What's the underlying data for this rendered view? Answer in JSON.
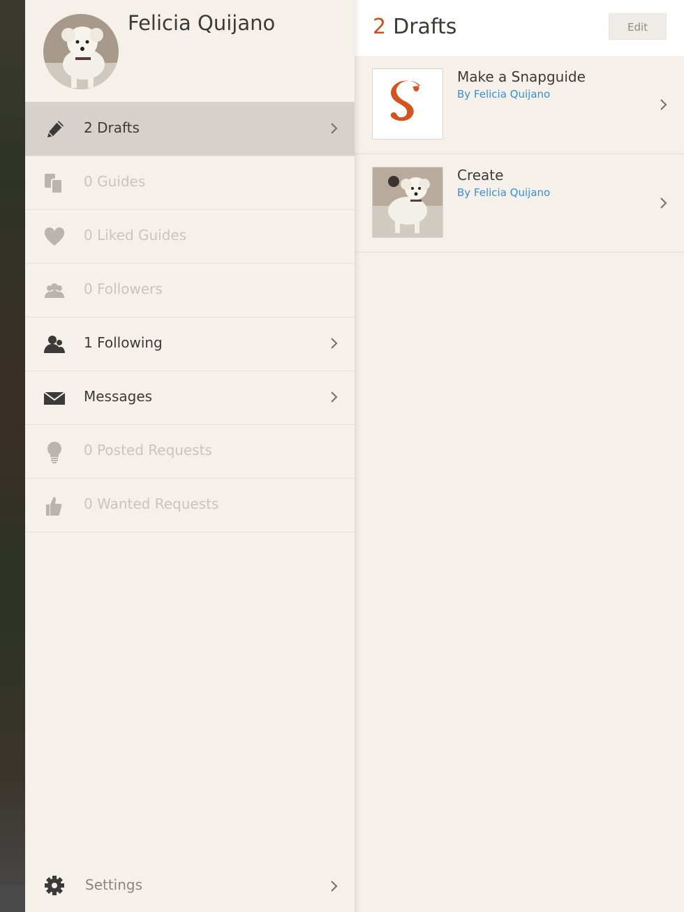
{
  "profile": {
    "name": "Felicia Quijano"
  },
  "sidebar": {
    "items": [
      {
        "label": "2 Drafts",
        "icon": "pencil-icon",
        "active": true,
        "enabled": true
      },
      {
        "label": "0 Guides",
        "icon": "guides-icon",
        "active": false,
        "enabled": false
      },
      {
        "label": "0 Liked Guides",
        "icon": "heart-icon",
        "active": false,
        "enabled": false
      },
      {
        "label": "0 Followers",
        "icon": "followers-icon",
        "active": false,
        "enabled": false
      },
      {
        "label": "1 Following",
        "icon": "following-icon",
        "active": false,
        "enabled": true
      },
      {
        "label": "Messages",
        "icon": "envelope-icon",
        "active": false,
        "enabled": true
      },
      {
        "label": "0 Posted Requests",
        "icon": "lightbulb-icon",
        "active": false,
        "enabled": false
      },
      {
        "label": "0 Wanted Requests",
        "icon": "thumbs-up-icon",
        "active": false,
        "enabled": false
      }
    ],
    "settings_label": "Settings"
  },
  "main": {
    "count": "2",
    "title": "Drafts",
    "edit_label": "Edit",
    "drafts": [
      {
        "title": "Make a Snapguide",
        "author": "By Felicia Quijano",
        "thumb": "snapguide-logo"
      },
      {
        "title": "Create",
        "author": "By Felicia Quijano",
        "thumb": "dog-photo"
      }
    ]
  },
  "colors": {
    "accent": "#c9501c",
    "link": "#3b8fd1",
    "panel": "#f5f0ea",
    "active_row": "#d6d1cb",
    "disabled_text": "#c9c4bd"
  }
}
